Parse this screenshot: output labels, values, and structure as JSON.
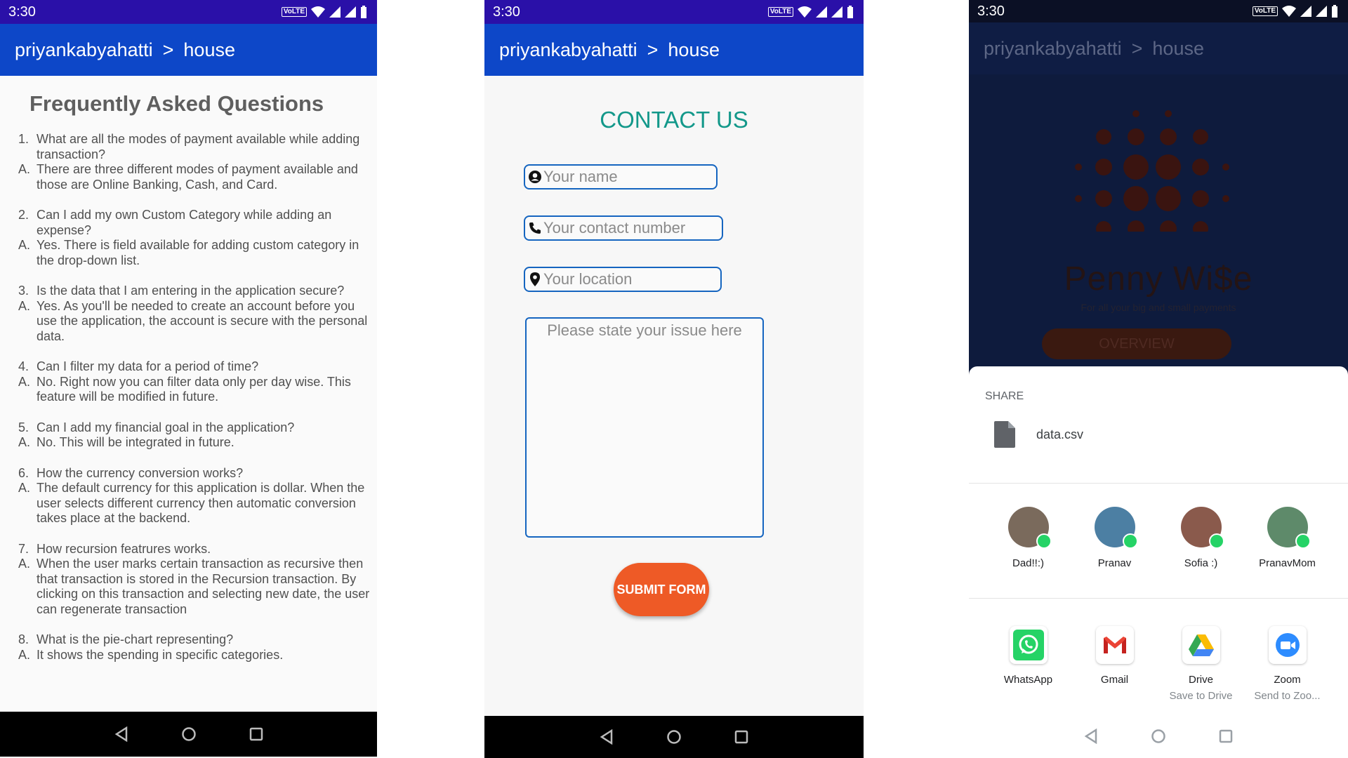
{
  "status": {
    "time": "3:30",
    "volte": "VoLTE"
  },
  "appbar": {
    "user": "priyankabyahatti",
    "separator": ">",
    "page": "house"
  },
  "faq": {
    "title": "Frequently Asked Questions",
    "items": [
      {
        "num": "1.",
        "q": "What are all the modes of payment available while adding transaction?",
        "a_label": "A.",
        "a": "There are three different modes of payment available and those are Online Banking, Cash, and Card."
      },
      {
        "num": "2.",
        "q": "Can I add my own Custom Category while adding an expense?",
        "a_label": "A.",
        "a": "Yes. There is field available for adding custom category in the drop-down list."
      },
      {
        "num": "3.",
        "q": "Is the data that I am entering in the application secure?",
        "a_label": "A.",
        "a": "Yes. As you'll be needed to create an account before you use the application, the account is secure with the personal data."
      },
      {
        "num": "4.",
        "q": "Can I filter my data for a period of time?",
        "a_label": "A.",
        "a": "No. Right now you can filter data only per day wise. This feature will be modified in future."
      },
      {
        "num": "5.",
        "q": "Can I add my financial goal in the application?",
        "a_label": "A.",
        "a": "No. This will be integrated in future."
      },
      {
        "num": "6.",
        "q": "How the currency conversion works?",
        "a_label": "A.",
        "a": "The default currency for this application is dollar. When the user selects different currency then automatic conversion takes place at the backend."
      },
      {
        "num": "7.",
        "q": "How recursion featrures works.",
        "a_label": "A.",
        "a": "When the user marks certain transaction as recursive then that transaction is stored in the Recursion transaction. By clicking on this transaction and selecting new date, the user can regenerate transaction"
      },
      {
        "num": "8.",
        "q": "What is the pie-chart representing?",
        "a_label": "A.",
        "a": "It shows the spending in specific categories."
      }
    ]
  },
  "contact": {
    "title": "CONTACT US",
    "name_placeholder": "Your name",
    "phone_placeholder": "Your contact number",
    "location_placeholder": "Your location",
    "issue_placeholder": "Please state your issue here",
    "submit_label": "SUBMIT FORM"
  },
  "background_app": {
    "logo_title": "Penny Wi$e",
    "tagline": "For all your big and small payments",
    "overview_label": "OVERVIEW"
  },
  "share": {
    "label": "SHARE",
    "file_name": "data.csv",
    "contacts": [
      {
        "name": "Dad!!:)",
        "color": "#7a6a5c"
      },
      {
        "name": "Pranav",
        "color": "#4c7fa3"
      },
      {
        "name": "Sofia :)",
        "color": "#8a5a4c"
      },
      {
        "name": "PranavMom",
        "color": "#5e8a6a"
      }
    ],
    "apps": [
      {
        "name": "WhatsApp",
        "sub": "",
        "icon": "whatsapp-icon"
      },
      {
        "name": "Gmail",
        "sub": "",
        "icon": "gmail-icon"
      },
      {
        "name": "Drive",
        "sub": "Save to Drive",
        "icon": "drive-icon"
      },
      {
        "name": "Zoom",
        "sub": "Send to Zoo...",
        "icon": "zoom-icon"
      }
    ]
  },
  "colors": {
    "status_bar": "#2a10a8",
    "app_bar": "#0d47c8",
    "contact_title": "#13988a",
    "field_border": "#1565c0",
    "submit": "#ee5a26"
  }
}
